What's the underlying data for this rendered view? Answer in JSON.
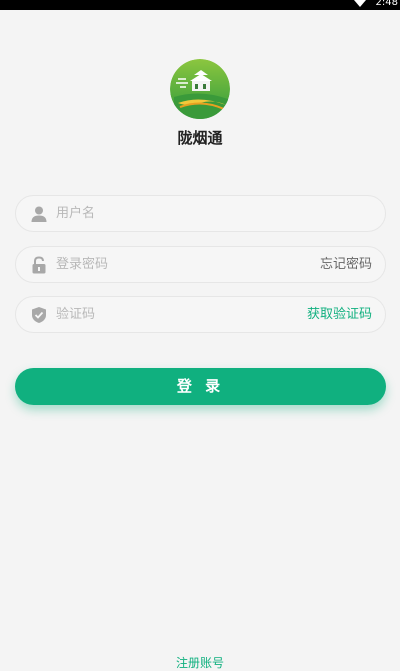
{
  "status_bar": {
    "time": "2:48",
    "icons": [
      "wifi-icon"
    ]
  },
  "app": {
    "name": "陇烟通",
    "logo_icon": "app-logo",
    "accent_color": "#10b07f"
  },
  "form": {
    "username": {
      "placeholder": "用户名",
      "value": "",
      "icon": "user-icon"
    },
    "password": {
      "placeholder": "登录密码",
      "value": "",
      "icon": "lock-icon",
      "link_label": "忘记密码"
    },
    "captcha": {
      "placeholder": "验证码",
      "value": "",
      "icon": "shield-icon",
      "link_label": "获取验证码"
    },
    "submit_label": "登 录"
  },
  "footer": {
    "register_label": "注册账号"
  }
}
